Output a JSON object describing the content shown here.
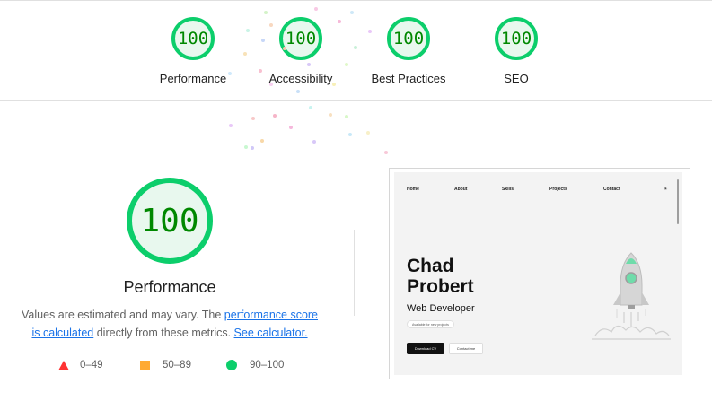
{
  "categories": [
    {
      "score": "100",
      "label": "Performance"
    },
    {
      "score": "100",
      "label": "Accessibility"
    },
    {
      "score": "100",
      "label": "Best Practices"
    },
    {
      "score": "100",
      "label": "SEO"
    }
  ],
  "main": {
    "score": "100",
    "title": "Performance",
    "desc_pre": "Values are estimated and may vary. The ",
    "desc_link1": "performance score is calculated",
    "desc_mid": " directly from these metrics. ",
    "desc_link2": "See calculator."
  },
  "legend": [
    {
      "range": "0–49",
      "color": "#ff3333"
    },
    {
      "range": "50–89",
      "color": "#ffaa33"
    },
    {
      "range": "90–100",
      "color": "#0cce6b"
    }
  ],
  "screenshot": {
    "nav": [
      "Home",
      "About",
      "Skills",
      "Projects",
      "Contact",
      "☀"
    ],
    "name": "Chad Probert",
    "role": "Web Developer",
    "badge": "Available for new projects",
    "btn_primary": "Download CV",
    "btn_secondary": "Contact me"
  },
  "colors": {
    "pass": "#0cce6b",
    "pass_text": "#008800",
    "link": "#1a73e8"
  }
}
